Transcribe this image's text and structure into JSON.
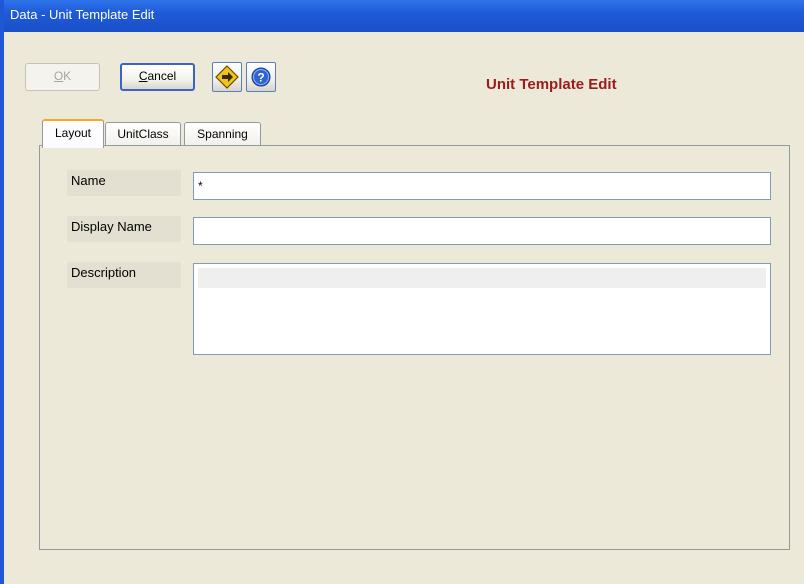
{
  "window": {
    "title": "Data - Unit Template Edit"
  },
  "toolbar": {
    "ok_label": "OK",
    "ok_mnemonic": "O",
    "ok_rest": "K",
    "cancel_label": "Cancel",
    "cancel_mnemonic": "C",
    "cancel_rest": "ancel"
  },
  "header": {
    "title": "Unit Template Edit",
    "title_color": "#9A1C1C"
  },
  "tabs": [
    {
      "label": "Layout",
      "active": true
    },
    {
      "label": "UnitClass",
      "active": false
    },
    {
      "label": "Spanning",
      "active": false
    }
  ],
  "form": {
    "name_label": "Name",
    "name_value": "*",
    "display_name_label": "Display Name",
    "display_name_value": "",
    "description_label": "Description",
    "description_value": ""
  },
  "colors": {
    "titlebar": "#1E5AD8",
    "dialog_bg": "#ECE9D8",
    "active_tab_accent": "#F3A82B"
  },
  "icons": {
    "toolbar_icon_1": "diamond-arrow-icon",
    "toolbar_icon_2": "help-icon"
  }
}
